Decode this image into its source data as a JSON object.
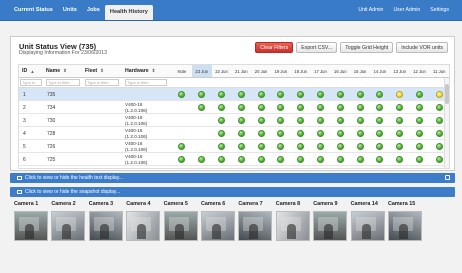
{
  "nav": {
    "left": [
      "Current Status",
      "Units",
      "Jobs",
      "Health History"
    ],
    "active": "Health History",
    "right": [
      "Unit Admin",
      "User Admin",
      "Settings"
    ]
  },
  "panel": {
    "title": "Unit Status View (735)",
    "subtitle": "Displaying Information For 23/06/2013",
    "buttons": {
      "clear_filters": "Clear Filters",
      "export_csv": "Export CSV...",
      "toggle_grid": "Toggle Grid Height",
      "include_vor": "Include VOR units"
    }
  },
  "grid": {
    "headers": {
      "id": "ID",
      "name": "Name",
      "fleet": "Fleet",
      "hardware": "Hardware",
      "id_sort": "▲",
      "sort": "⇕"
    },
    "filter_placeholder": "Type to filter",
    "filter_select": "",
    "dates": [
      "Note",
      "23 Jun",
      "22 Jun",
      "21 Jun",
      "20 Jun",
      "19 Jun",
      "18 Jun",
      "17 Jun",
      "16 Jun",
      "15 Jun",
      "14 Jun",
      "13 Jun",
      "12 Jun",
      "11 Jun",
      "10 Jun"
    ],
    "selected_date": "23 Jun",
    "rows": [
      {
        "id": "1",
        "name": "735",
        "hw1": "",
        "hw2": "",
        "status": [
          "g",
          "g",
          "g",
          "g",
          "g",
          "g",
          "g",
          "g",
          "g",
          "g",
          "g",
          "y",
          "g",
          "y",
          "g"
        ]
      },
      {
        "id": "2",
        "name": "734",
        "hw1": "V400-16",
        "hw2": "(1.2.0.106)",
        "status": [
          "",
          "g",
          "g",
          "g",
          "g",
          "g",
          "g",
          "g",
          "g",
          "g",
          "g",
          "g",
          "g",
          "g",
          "g"
        ]
      },
      {
        "id": "3",
        "name": "730",
        "hw1": "V400-16",
        "hw2": "(1.2.0.106)",
        "status": [
          "",
          "",
          "g",
          "g",
          "g",
          "g",
          "g",
          "g",
          "g",
          "g",
          "g",
          "g",
          "g",
          "g",
          "g"
        ]
      },
      {
        "id": "4",
        "name": "728",
        "hw1": "V400-16",
        "hw2": "(1.2.0.106)",
        "status": [
          "",
          "",
          "g",
          "g",
          "g",
          "g",
          "g",
          "g",
          "g",
          "g",
          "g",
          "g",
          "g",
          "g",
          "g"
        ]
      },
      {
        "id": "5",
        "name": "726",
        "hw1": "V400-16",
        "hw2": "(1.2.0.106)",
        "status": [
          "g",
          "",
          "g",
          "g",
          "g",
          "g",
          "g",
          "g",
          "g",
          "g",
          "g",
          "g",
          "g",
          "g",
          "g"
        ]
      },
      {
        "id": "6",
        "name": "725",
        "hw1": "V400-16",
        "hw2": "(1.2.0.106)",
        "status": [
          "g",
          "g",
          "g",
          "g",
          "g",
          "g",
          "g",
          "g",
          "g",
          "g",
          "g",
          "g",
          "g",
          "g",
          "g"
        ]
      }
    ]
  },
  "bars": {
    "health": "Click to view or hide the health text display...",
    "snapshot": "Click to view or hide the snapshot display..."
  },
  "cameras": [
    "Camera 1",
    "Camera 2",
    "Camera 3",
    "Camera 4",
    "Camera 5",
    "Camera 6",
    "Camera 7",
    "Camera 8",
    "Camera 9",
    "Camera 14",
    "Camera 15"
  ],
  "colors": {
    "nav": "#3a7bc8",
    "bar": "#3d7cc9",
    "clear_filters": "#d9534f",
    "status_green": "#4fb232",
    "status_yellow": "#f0dc3a"
  }
}
